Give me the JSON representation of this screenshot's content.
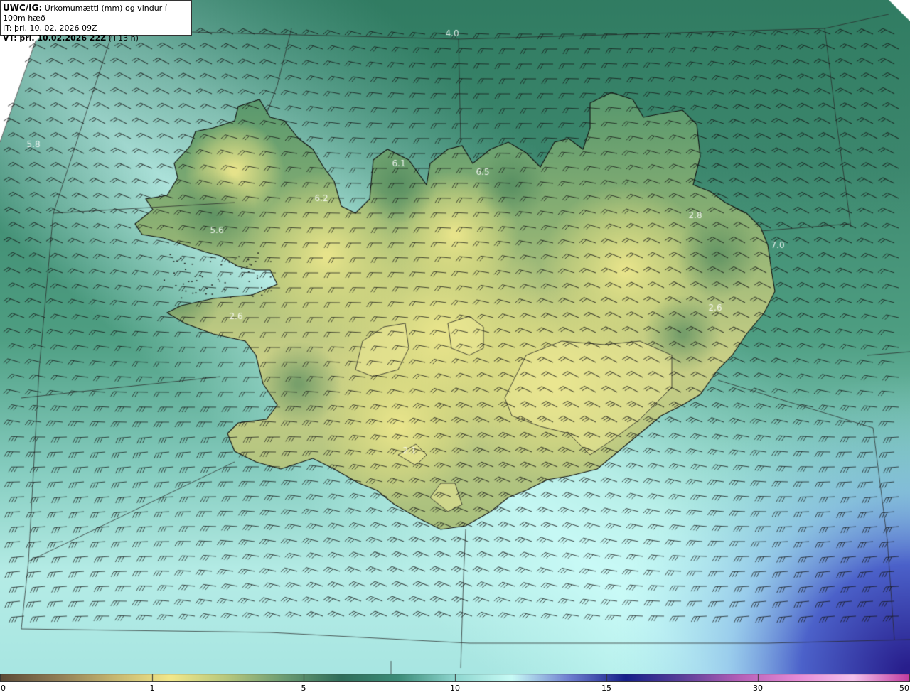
{
  "header": {
    "model": "UWC/IG:",
    "title": "Úrkomumætti (mm) og vindur í 100m hæð",
    "it_prefix": "IT:",
    "it_value": "þri. 10. 02. 2026 09Z",
    "vt_prefix": "VT:",
    "vt_value": "þri. 10.02.2026 22Z",
    "vt_offset": "(+13 h)"
  },
  "map_labels": [
    "4.0",
    "5.8",
    "6.1",
    "6.5",
    "6.2",
    "5.6",
    "2.8",
    "7.0",
    "2.6",
    "2.6",
    "2.1"
  ],
  "colorbar": {
    "ticks": [
      "0",
      "1",
      "5",
      "10",
      "15",
      "30",
      "50"
    ],
    "colors": [
      "#5c4a36",
      "#8f7c55",
      "#c5b670",
      "#f2e88a",
      "#b6c77c",
      "#6b9b72",
      "#2f6d5a",
      "#3c8c78",
      "#8ed6cf",
      "#c8fbf6",
      "#6f7fd0",
      "#16208a",
      "#5b3f9a",
      "#b45fb8",
      "#e58ad5",
      "#f4c2ec",
      "#c03aa0"
    ]
  }
}
